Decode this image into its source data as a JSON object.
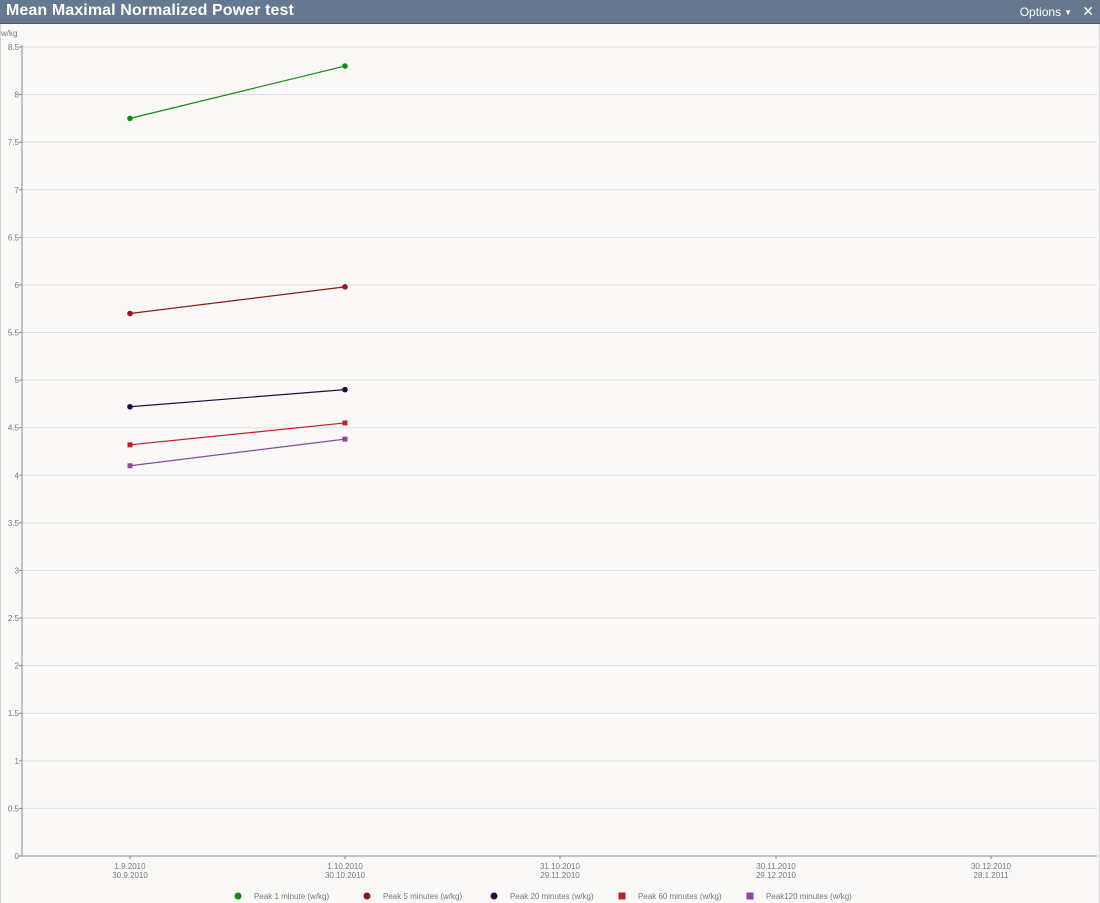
{
  "window": {
    "title": "Mean Maximal Normalized Power test",
    "options_label": "Options",
    "close_glyph": "✕"
  },
  "chart_data": {
    "type": "line",
    "ylabel": "w/kg",
    "ylim": [
      0,
      8.5
    ],
    "yticks": [
      "0",
      "0.5",
      "1",
      "1.5",
      "2",
      "2.5",
      "3",
      "3.5",
      "4",
      "4.5",
      "5",
      "5.5",
      "6",
      "6.5",
      "7",
      "7.5",
      "8",
      "8.5"
    ],
    "categories": [
      [
        "1.9.2010",
        "30.9.2010"
      ],
      [
        "1.10.2010",
        "30.10.2010"
      ],
      [
        "31.10.2010",
        "29.11.2010"
      ],
      [
        "30.11.2010",
        "29.12.2010"
      ],
      [
        "30.12.2010",
        "28.1.2011"
      ]
    ],
    "grid": true,
    "legend_position": "bottom",
    "series": [
      {
        "name": "Peak 1 minute (w/kg)",
        "color": "#108a10",
        "marker": "circle",
        "values": [
          7.75,
          8.3
        ]
      },
      {
        "name": "Peak 5 minutes (w/kg)",
        "color": "#8b1a1a",
        "marker": "circle",
        "values": [
          5.7,
          5.98
        ]
      },
      {
        "name": "Peak 20 minutes (w/kg)",
        "color": "#2a0a3e",
        "marker": "circle",
        "values": [
          4.72,
          4.9
        ]
      },
      {
        "name": "Peak 60 minutes (w/kg)",
        "color": "#c0202a",
        "marker": "square",
        "values": [
          4.32,
          4.55
        ]
      },
      {
        "name": "Peak120 minutes (w/kg)",
        "color": "#8a4a9a",
        "marker": "square",
        "values": [
          4.1,
          4.38
        ]
      }
    ]
  }
}
